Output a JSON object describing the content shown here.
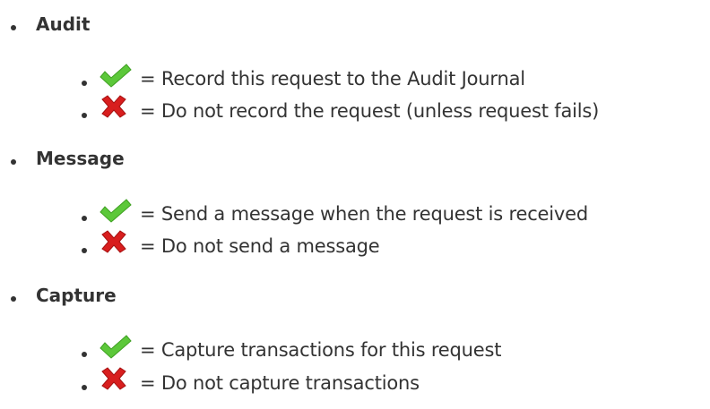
{
  "sections": [
    {
      "heading": "Audit",
      "items": [
        {
          "icon": "green-check-icon",
          "text": "= Record this request to the Audit Journal"
        },
        {
          "icon": "red-x-icon",
          "text": "= Do not record the request (unless request fails)"
        }
      ]
    },
    {
      "heading": "Message",
      "items": [
        {
          "icon": "green-check-icon",
          "text": "= Send a message when the request is received"
        },
        {
          "icon": "red-x-icon",
          "text": "= Do not send a message"
        }
      ]
    },
    {
      "heading": "Capture",
      "items": [
        {
          "icon": "green-check-icon",
          "text": "= Capture transactions for this request"
        },
        {
          "icon": "red-x-icon",
          "text": "= Do not capture transactions"
        }
      ]
    }
  ],
  "colors": {
    "check": "#5cc83a",
    "cross": "#d81e1e",
    "text": "#333333"
  }
}
